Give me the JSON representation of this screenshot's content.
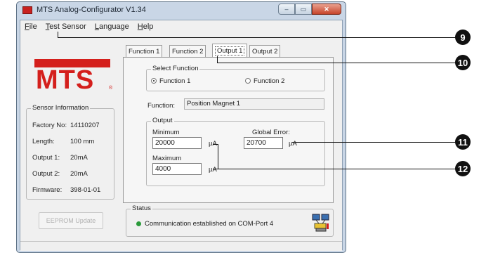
{
  "window": {
    "title": "MTS  Analog-Configurator V1.34",
    "caption_min": "–",
    "caption_max": "▭",
    "caption_close": "✕"
  },
  "menu": {
    "items": [
      {
        "key": "file",
        "accel": "F",
        "rest": "ile"
      },
      {
        "key": "test_sensor",
        "accel": "T",
        "rest": "est Sensor"
      },
      {
        "key": "language",
        "accel": "L",
        "rest": "anguage"
      },
      {
        "key": "help",
        "accel": "H",
        "rest": "elp"
      }
    ]
  },
  "logo": {
    "text": "MTS",
    "registered": "®"
  },
  "sensor_info": {
    "title": "Sensor Information",
    "rows": [
      {
        "label": "Factory No:",
        "value": "14110207"
      },
      {
        "label": "Length:",
        "value": "100 mm"
      },
      {
        "label": "Output 1:",
        "value": "20mA"
      },
      {
        "label": "Output 2:",
        "value": "20mA"
      },
      {
        "label": "Firmware:",
        "value": "398-01-01"
      }
    ]
  },
  "eeprom_button": "EEPROM Update",
  "tabs": [
    {
      "label": "Function 1",
      "active": false
    },
    {
      "label": "Function 2",
      "active": false
    },
    {
      "label": "Output 1",
      "active": true
    },
    {
      "label": "Output 2",
      "active": false
    }
  ],
  "select_function": {
    "title": "Select Function",
    "option1": "Function 1",
    "option2": "Function 2",
    "selected": "Function 1"
  },
  "function_field": {
    "label": "Function:",
    "value": "Position Magnet 1"
  },
  "output_group": {
    "title": "Output",
    "minimum_label": "Minimum",
    "minimum_value": "20000",
    "minimum_unit": "µA",
    "maximum_label": "Maximum",
    "maximum_value": "4000",
    "maximum_unit": "µA",
    "global_error_label": "Global Error:",
    "global_error_value": "20700",
    "global_error_unit": "µA"
  },
  "status": {
    "title": "Status",
    "message": "Communication established on COM-Port 4",
    "indicator_color": "#2a9a3a"
  },
  "callouts": {
    "c9": "9",
    "c10": "10",
    "c11": "11",
    "c12": "12"
  },
  "colors": {
    "brand": "#d41f1c",
    "callout": "#111111"
  }
}
